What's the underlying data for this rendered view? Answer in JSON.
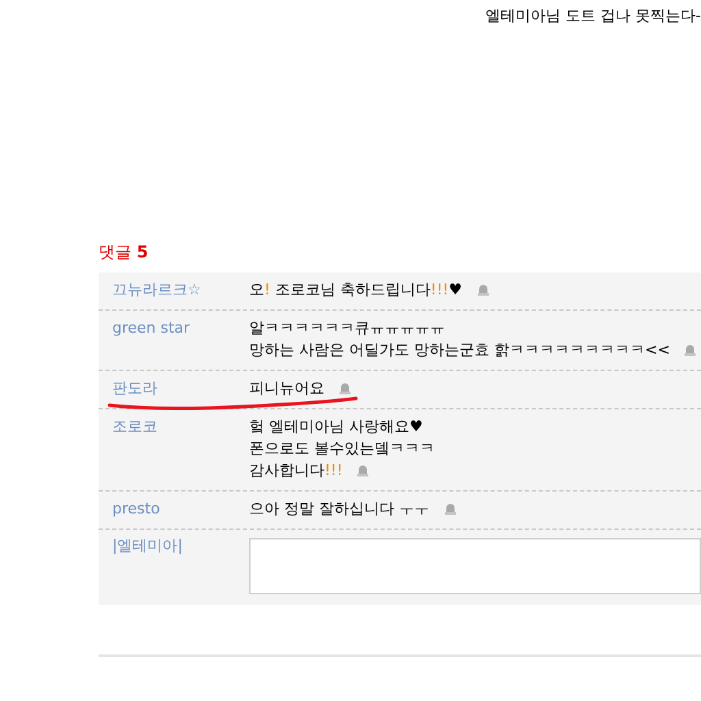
{
  "post_title": "엘테미아님 도트 겁나 못찍는다-",
  "comments_heading": "댓글 **5**",
  "comments": [
    {
      "author": "끄뉴라르크☆",
      "lines": [
        [
          {
            "text": "오",
            "accent": false
          },
          {
            "text": "!",
            "accent": true
          },
          {
            "text": " 조로코님 축하드립니다",
            "accent": false
          },
          {
            "text": "!!!",
            "accent": true
          },
          {
            "text": "♥",
            "accent": false
          }
        ]
      ],
      "highlighted": false
    },
    {
      "author": "green star",
      "lines": [
        [
          {
            "text": "알ㅋㅋㅋㅋㅋㅋ큐ㅠㅠㅠㅠㅠ",
            "accent": false
          }
        ],
        [
          {
            "text": "망하는 사람은 어딜가도 망하는군효 핡ㅋㅋㅋㅋㅋㅋㅋㅋㅋ<<",
            "accent": false
          }
        ]
      ],
      "highlighted": false
    },
    {
      "author": "판도라",
      "lines": [
        [
          {
            "text": "피니뉴어요",
            "accent": false
          }
        ]
      ],
      "highlighted": true
    },
    {
      "author": "조로코",
      "lines": [
        [
          {
            "text": "헠 엘테미아님 사랑해요♥",
            "accent": false
          }
        ],
        [
          {
            "text": "폰으로도 볼수있는뎈ㅋㅋㅋ",
            "accent": false
          }
        ],
        [
          {
            "text": "감사합니다",
            "accent": false
          },
          {
            "text": "!!!",
            "accent": true
          }
        ]
      ],
      "highlighted": false
    },
    {
      "author": "presto",
      "lines": [
        [
          {
            "text": "으아 정말 잘하십니다 ㅜㅜ",
            "accent": false
          }
        ]
      ],
      "highlighted": false
    }
  ],
  "reply_form": {
    "author": "|엘테미아|"
  }
}
